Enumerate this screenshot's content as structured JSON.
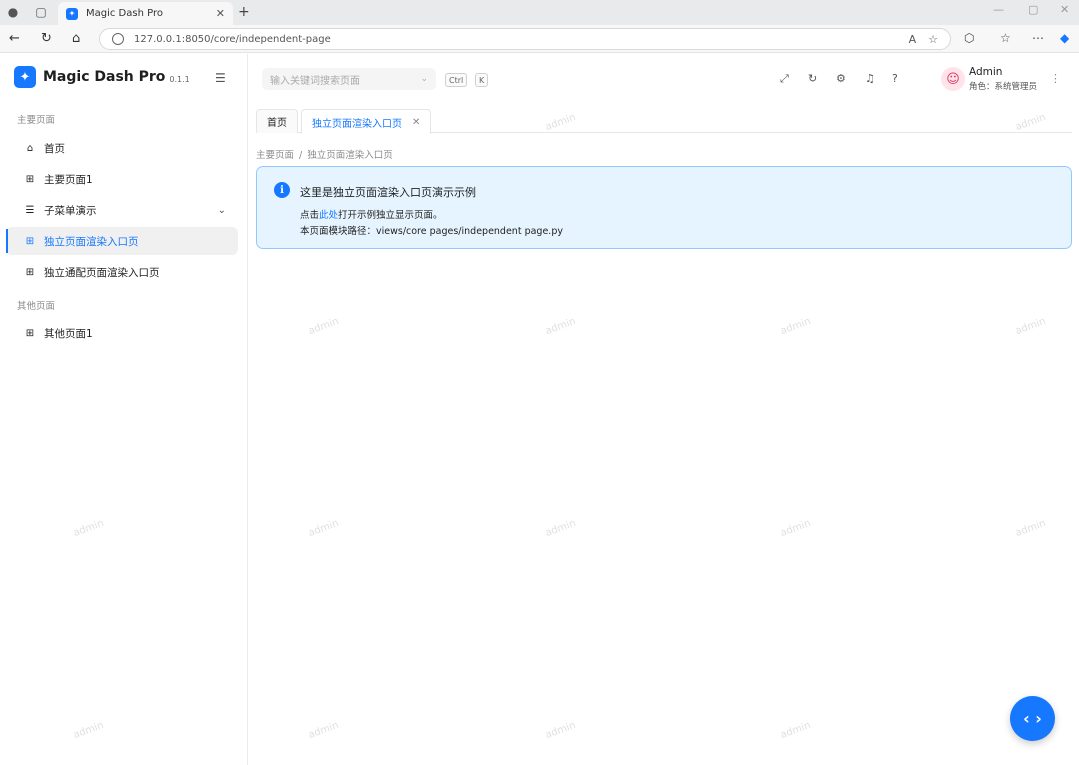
{
  "browser": {
    "tab_title": "Magic Dash Pro",
    "url": "127.0.0.1:8050/core/independent-page"
  },
  "sidebar": {
    "brand_name": "Magic Dash Pro",
    "version": "0.1.1",
    "group_main": "主要页面",
    "group_other": "其他页面",
    "items": [
      {
        "label": "首页"
      },
      {
        "label": "主要页面1"
      },
      {
        "label": "子菜单演示"
      },
      {
        "label": "独立页面渲染入口页"
      },
      {
        "label": "独立通配页面渲染入口页"
      },
      {
        "label": "其他页面1"
      }
    ]
  },
  "header": {
    "search_placeholder": "输入关键词搜索页面",
    "kbd_ctrl": "Ctrl",
    "kbd_k": "K",
    "user_name": "Admin",
    "user_role": "角色：系统管理员"
  },
  "tabs": {
    "home": "首页",
    "current": "独立页面渲染入口页"
  },
  "breadcrumb": {
    "parent": "主要页面",
    "current": "独立页面渲染入口页"
  },
  "alert": {
    "title": "这里是独立页面渲染入口页演示示例",
    "line1_prefix": "点击",
    "line1_link": "此处",
    "line1_suffix": "打开示例独立显示页面。",
    "line2": "本页面模块路径：views/core pages/independent page.py"
  },
  "watermark": "admin",
  "colors": {
    "accent": "#1677ff",
    "alert_bg": "#e6f4ff",
    "alert_border": "#91caff"
  }
}
